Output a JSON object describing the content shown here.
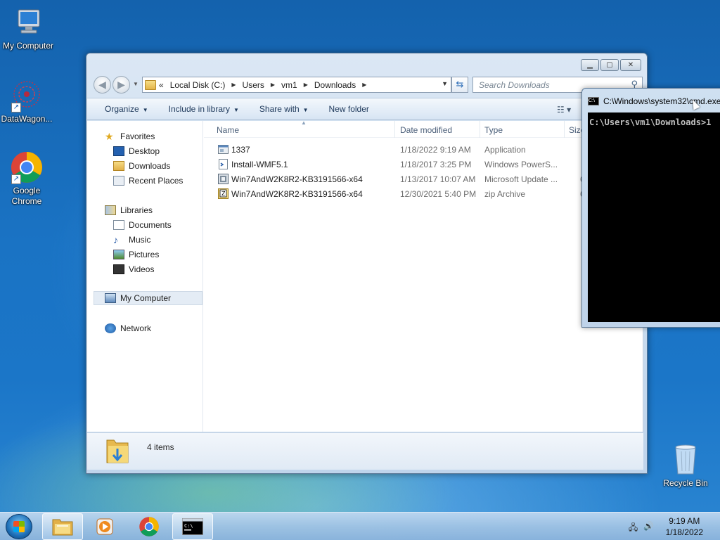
{
  "desktop": {
    "icons": [
      {
        "label": "My Computer"
      },
      {
        "label": "DataWagon..."
      },
      {
        "label": "Google Chrome"
      },
      {
        "label": "Recycle Bin"
      }
    ]
  },
  "explorer": {
    "window_buttons": {
      "minimize": "▁",
      "maximize": "▢",
      "close": "✕"
    },
    "address": {
      "prefix": "«",
      "crumbs": [
        "Local Disk (C:)",
        "Users",
        "vm1",
        "Downloads"
      ]
    },
    "search": {
      "placeholder": "Search Downloads"
    },
    "toolbar": {
      "organize": "Organize",
      "include_in_library": "Include in library",
      "share_with": "Share with",
      "new_folder": "New folder"
    },
    "nav_pane": {
      "favorites_header": "Favorites",
      "favorites": [
        "Desktop",
        "Downloads",
        "Recent Places"
      ],
      "libraries_header": "Libraries",
      "libraries": [
        "Documents",
        "Music",
        "Pictures",
        "Videos"
      ],
      "computer": "My Computer",
      "network": "Network"
    },
    "columns": {
      "name": "Name",
      "date_modified": "Date modified",
      "type": "Type",
      "size": "Size"
    },
    "files": [
      {
        "name": "1337",
        "date": "1/18/2022 9:19 AM",
        "type": "Application",
        "size": "",
        "icon": "application-icon"
      },
      {
        "name": "Install-WMF5.1",
        "date": "1/18/2017 3:25 PM",
        "type": "Windows PowerS...",
        "size": "",
        "icon": "powershell-script-icon"
      },
      {
        "name": "Win7AndW2K8R2-KB3191566-x64",
        "date": "1/13/2017 10:07 AM",
        "type": "Microsoft Update ...",
        "size": "6",
        "icon": "msu-package-icon"
      },
      {
        "name": "Win7AndW2K8R2-KB3191566-x64",
        "date": "12/30/2021 5:40 PM",
        "type": "zip Archive",
        "size": "6",
        "icon": "zip-archive-icon"
      }
    ],
    "details_pane": {
      "item_count": "4 items"
    }
  },
  "cmd": {
    "title": "C:\\Windows\\system32\\cmd.exe",
    "prompt": "C:\\Users\\vm1\\Downloads>1"
  },
  "taskbar": {
    "clock_time": "9:19 AM",
    "clock_date": "1/18/2022",
    "tasks": [
      "windows-explorer-icon",
      "media-player-icon",
      "chrome-icon",
      "cmd-icon"
    ]
  }
}
